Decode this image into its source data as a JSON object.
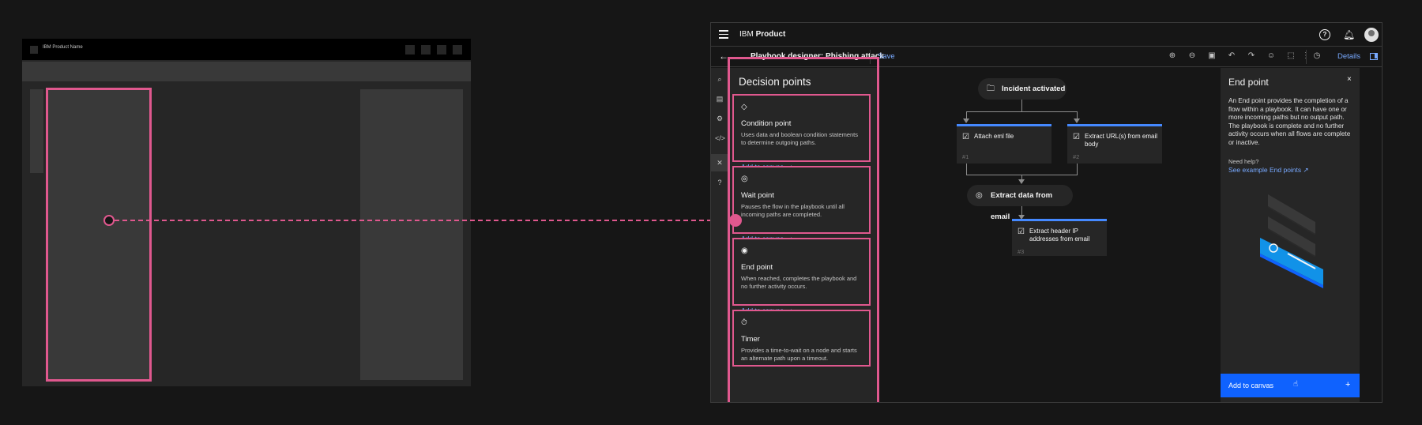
{
  "wireframe": {
    "product_name": "IBM Product Name"
  },
  "app": {
    "brand_prefix": "IBM",
    "brand_name": "Product",
    "playbook_title": "Playbook designer: Phishing attack",
    "save_label": "Save",
    "details_label": "Details",
    "icons": [
      "menu-icon",
      "help-icon",
      "notification-icon",
      "avatar",
      "zoom-in-icon",
      "zoom-out-icon",
      "fit-icon",
      "undo-icon",
      "redo-icon",
      "user-icon",
      "select-icon",
      "overflow-icon",
      "history-icon",
      "panel-icon"
    ]
  },
  "decision_panel": {
    "title": "Decision points",
    "cards": [
      {
        "icon": "diamond-icon",
        "title": "Condition point",
        "description": "Uses data and boolean condition statements to determine outgoing paths.",
        "action": "Add to canvas"
      },
      {
        "icon": "pause-icon",
        "title": "Wait point",
        "description": "Pauses the flow in the playbook until all incoming paths are completed.",
        "action": "Add to canvas"
      },
      {
        "icon": "stop-icon",
        "title": "End point",
        "description": "When reached, completes the playbook and no further activity occurs.",
        "action": "Add to canvas"
      },
      {
        "icon": "timer-icon",
        "title": "Timer",
        "description": "Provides a time-to-wait on a node and starts an alternate path upon a timeout.",
        "action": ""
      }
    ]
  },
  "flow": {
    "start": "Incident activated",
    "node1": {
      "label": "Attach eml file",
      "num": "#1"
    },
    "node2": {
      "label": "Extract URL(s)  from email body",
      "num": "#2"
    },
    "wait": "Extract data from email",
    "node3": {
      "label": "Extract header IP addresses from email",
      "num": "#3"
    }
  },
  "detail_panel": {
    "title": "End point",
    "close": "×",
    "description": "An End point provides the completion of a flow within a playbook. It can have one or more incoming paths but no output path. The playbook is complete and no further activity occurs when all flows are complete or inactive.",
    "need_help": "Need help?",
    "example_link": "See example End points",
    "add_label": "Add to canvas",
    "add_plus": "+"
  },
  "colors": {
    "highlight": "#e0588e",
    "accent_blue": "#0f62fe",
    "link_blue": "#78a9ff",
    "background": "#161616",
    "layer": "#262626"
  }
}
